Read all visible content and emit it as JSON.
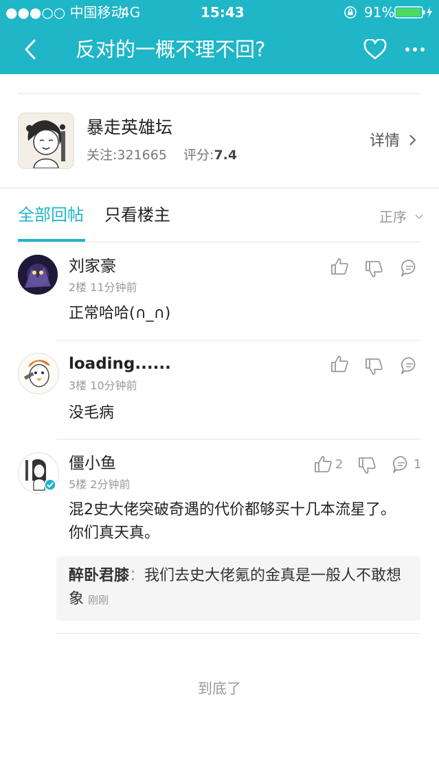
{
  "status_bar": {
    "carrier": "●●●○○ 中国移动",
    "network": "4G",
    "time": "15:43",
    "battery": "91%"
  },
  "nav": {
    "title": "反对的一概不理不回?",
    "back_icon": "chevron-left-icon",
    "favorite_icon": "heart-icon",
    "more_icon": "more-icon"
  },
  "forum": {
    "name": "暴走英雄坛",
    "followers_label": "关注:",
    "followers": "321665",
    "rating_label": "评分:",
    "rating": "7.4",
    "detail_label": "详情"
  },
  "tabs": {
    "all": "全部回帖",
    "owner_only": "只看楼主",
    "sort": "正序"
  },
  "posts": [
    {
      "user": "刘家豪",
      "floor": "2楼",
      "time": "11分钟前",
      "text": "正常哈哈(∩_∩)",
      "likes": "",
      "comments": ""
    },
    {
      "user": "loading......",
      "floor": "3楼",
      "time": "10分钟前",
      "text": "没毛病",
      "likes": "",
      "comments": ""
    },
    {
      "user": "僵小鱼",
      "floor": "5楼",
      "time": "2分钟前",
      "text": "混2史大佬突破奇遇的代价都够买十几本流星了。你们真天真。",
      "likes": "2",
      "comments": "1",
      "reply": {
        "author": "醉卧君膝",
        "separator": "：",
        "text": "我们去史大佬氪的金真是一般人不敢想象",
        "time": "刚刚"
      }
    }
  ],
  "footer": {
    "end_text": "到底了"
  },
  "colors": {
    "accent": "#1fb6c7",
    "battery": "#4cd964"
  }
}
